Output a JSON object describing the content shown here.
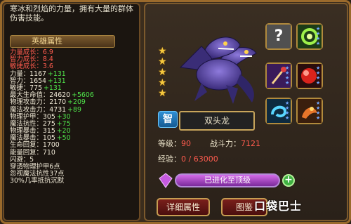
{
  "left_panel": {
    "description": "寒冰和烈焰的力量，拥有大量的群体伤害技能。",
    "header": "英雄属性",
    "growth": [
      {
        "label": "力量成长：",
        "value": "6.9"
      },
      {
        "label": "智力成长：",
        "value": "8.4"
      },
      {
        "label": "敏捷成长：",
        "value": "3.6"
      }
    ],
    "stats": [
      {
        "label": "力量：",
        "value": "1167",
        "bonus": "+131"
      },
      {
        "label": "智力：",
        "value": "1654",
        "bonus": "+131"
      },
      {
        "label": "敏捷：",
        "value": "775",
        "bonus": "+131"
      },
      {
        "label": "最大生命值：",
        "value": "24620",
        "bonus": "+5606"
      },
      {
        "label": "物理攻击力：",
        "value": "2170",
        "bonus": "+209"
      },
      {
        "label": "魔法攻击力：",
        "value": "4731",
        "bonus": "+89"
      },
      {
        "label": "物理护甲：",
        "value": "305",
        "bonus": "+30"
      },
      {
        "label": "魔法抗性：",
        "value": "275",
        "bonus": "+75"
      },
      {
        "label": "物理暴击：",
        "value": "315",
        "bonus": "+20"
      },
      {
        "label": "魔法暴击：",
        "value": "105",
        "bonus": "+50"
      },
      {
        "label": "生命回复：",
        "value": "1700",
        "bonus": ""
      },
      {
        "label": "能量回复：",
        "value": "710",
        "bonus": ""
      },
      {
        "label": "闪避：",
        "value": "5",
        "bonus": ""
      }
    ],
    "passives": [
      "穿透物理护甲6点",
      "忽视魔法抗性37点",
      "30%几率抵抗沉默"
    ]
  },
  "right_panel": {
    "stars": 5,
    "badge": "智",
    "hero_name": "双头龙",
    "level_label": "等级：",
    "level_value": "90",
    "power_label": "战斗力：",
    "power_value": "7121",
    "exp_label": "经验：",
    "exp_value": "0 / 63000",
    "evolve_label": "已进化至顶级",
    "plus_label": "+",
    "detail_button": "详细属性",
    "book_button": "图鉴",
    "watermark": "口袋巴士"
  },
  "colors": {
    "gold_border": "#c79d52",
    "growth_red": "#ff5b4e",
    "bonus_green": "#4fe34a",
    "evolve_purple": "#a94ac6",
    "star_yellow": "#f6c93e"
  }
}
